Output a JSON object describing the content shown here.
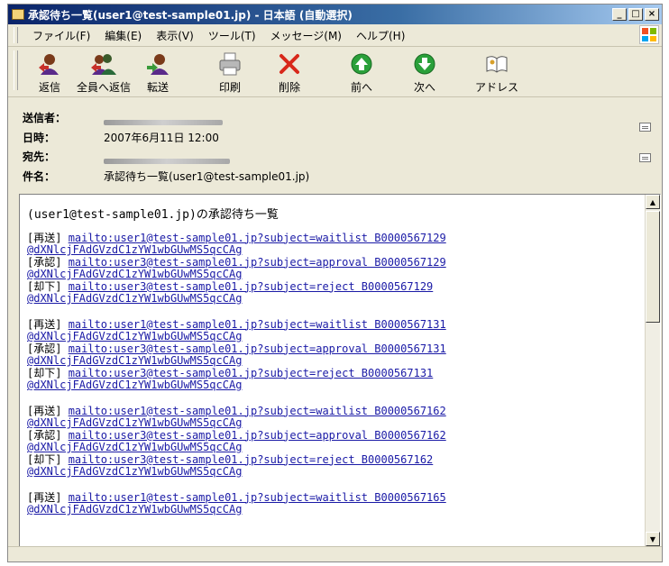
{
  "window": {
    "title": "承認待ち一覧(user1@test-sample01.jp) - 日本語 (自動選択)",
    "controls": {
      "minimize": "_",
      "maximize": "□",
      "close": "×"
    }
  },
  "menu": [
    "ファイル(F)",
    "編集(E)",
    "表示(V)",
    "ツール(T)",
    "メッセージ(M)",
    "ヘルプ(H)"
  ],
  "toolbar": [
    {
      "label": "返信",
      "icon": "reply-icon"
    },
    {
      "label": "全員へ返信",
      "icon": "reply-all-icon"
    },
    {
      "label": "転送",
      "icon": "forward-icon"
    },
    {
      "label": "印刷",
      "icon": "print-icon"
    },
    {
      "label": "削除",
      "icon": "delete-icon"
    },
    {
      "label": "前へ",
      "icon": "previous-icon"
    },
    {
      "label": "次へ",
      "icon": "next-icon"
    },
    {
      "label": "アドレス",
      "icon": "address-book-icon"
    }
  ],
  "headers": {
    "from_label": "送信者：",
    "date_label": "日時：",
    "date_value": "2007年6月11日 12:00",
    "to_label": "宛先：",
    "subject_label": "件名：",
    "subject_value": "承認待ち一覧(user1@test-sample01.jp)"
  },
  "body": {
    "intro": "(user1@test-sample01.jp)の承認待ち一覧",
    "groups": [
      [
        {
          "tag": "[再送]",
          "link": "mailto:user1@test-sample01.jp?subject=waitlist B0000567129",
          "cont": "@dXNlcjFAdGVzdC1zYW1wbGUwMS5qcCAg"
        },
        {
          "tag": "[承認]",
          "link": "mailto:user3@test-sample01.jp?subject=approval B0000567129",
          "cont": "@dXNlcjFAdGVzdC1zYW1wbGUwMS5qcCAg"
        },
        {
          "tag": "[却下]",
          "link": "mailto:user3@test-sample01.jp?subject=reject B0000567129",
          "cont": "@dXNlcjFAdGVzdC1zYW1wbGUwMS5qcCAg"
        }
      ],
      [
        {
          "tag": "[再送]",
          "link": "mailto:user1@test-sample01.jp?subject=waitlist B0000567131",
          "cont": "@dXNlcjFAdGVzdC1zYW1wbGUwMS5qcCAg"
        },
        {
          "tag": "[承認]",
          "link": "mailto:user3@test-sample01.jp?subject=approval B0000567131",
          "cont": "@dXNlcjFAdGVzdC1zYW1wbGUwMS5qcCAg"
        },
        {
          "tag": "[却下]",
          "link": "mailto:user3@test-sample01.jp?subject=reject B0000567131",
          "cont": "@dXNlcjFAdGVzdC1zYW1wbGUwMS5qcCAg"
        }
      ],
      [
        {
          "tag": "[再送]",
          "link": "mailto:user1@test-sample01.jp?subject=waitlist B0000567162",
          "cont": "@dXNlcjFAdGVzdC1zYW1wbGUwMS5qcCAg"
        },
        {
          "tag": "[承認]",
          "link": "mailto:user3@test-sample01.jp?subject=approval B0000567162",
          "cont": "@dXNlcjFAdGVzdC1zYW1wbGUwMS5qcCAg"
        },
        {
          "tag": "[却下]",
          "link": "mailto:user3@test-sample01.jp?subject=reject B0000567162",
          "cont": "@dXNlcjFAdGVzdC1zYW1wbGUwMS5qcCAg"
        }
      ],
      [
        {
          "tag": "[再送]",
          "link": "mailto:user1@test-sample01.jp?subject=waitlist B0000567165",
          "cont": "@dXNlcjFAdGVzdC1zYW1wbGUwMS5qcCAg"
        }
      ]
    ]
  }
}
